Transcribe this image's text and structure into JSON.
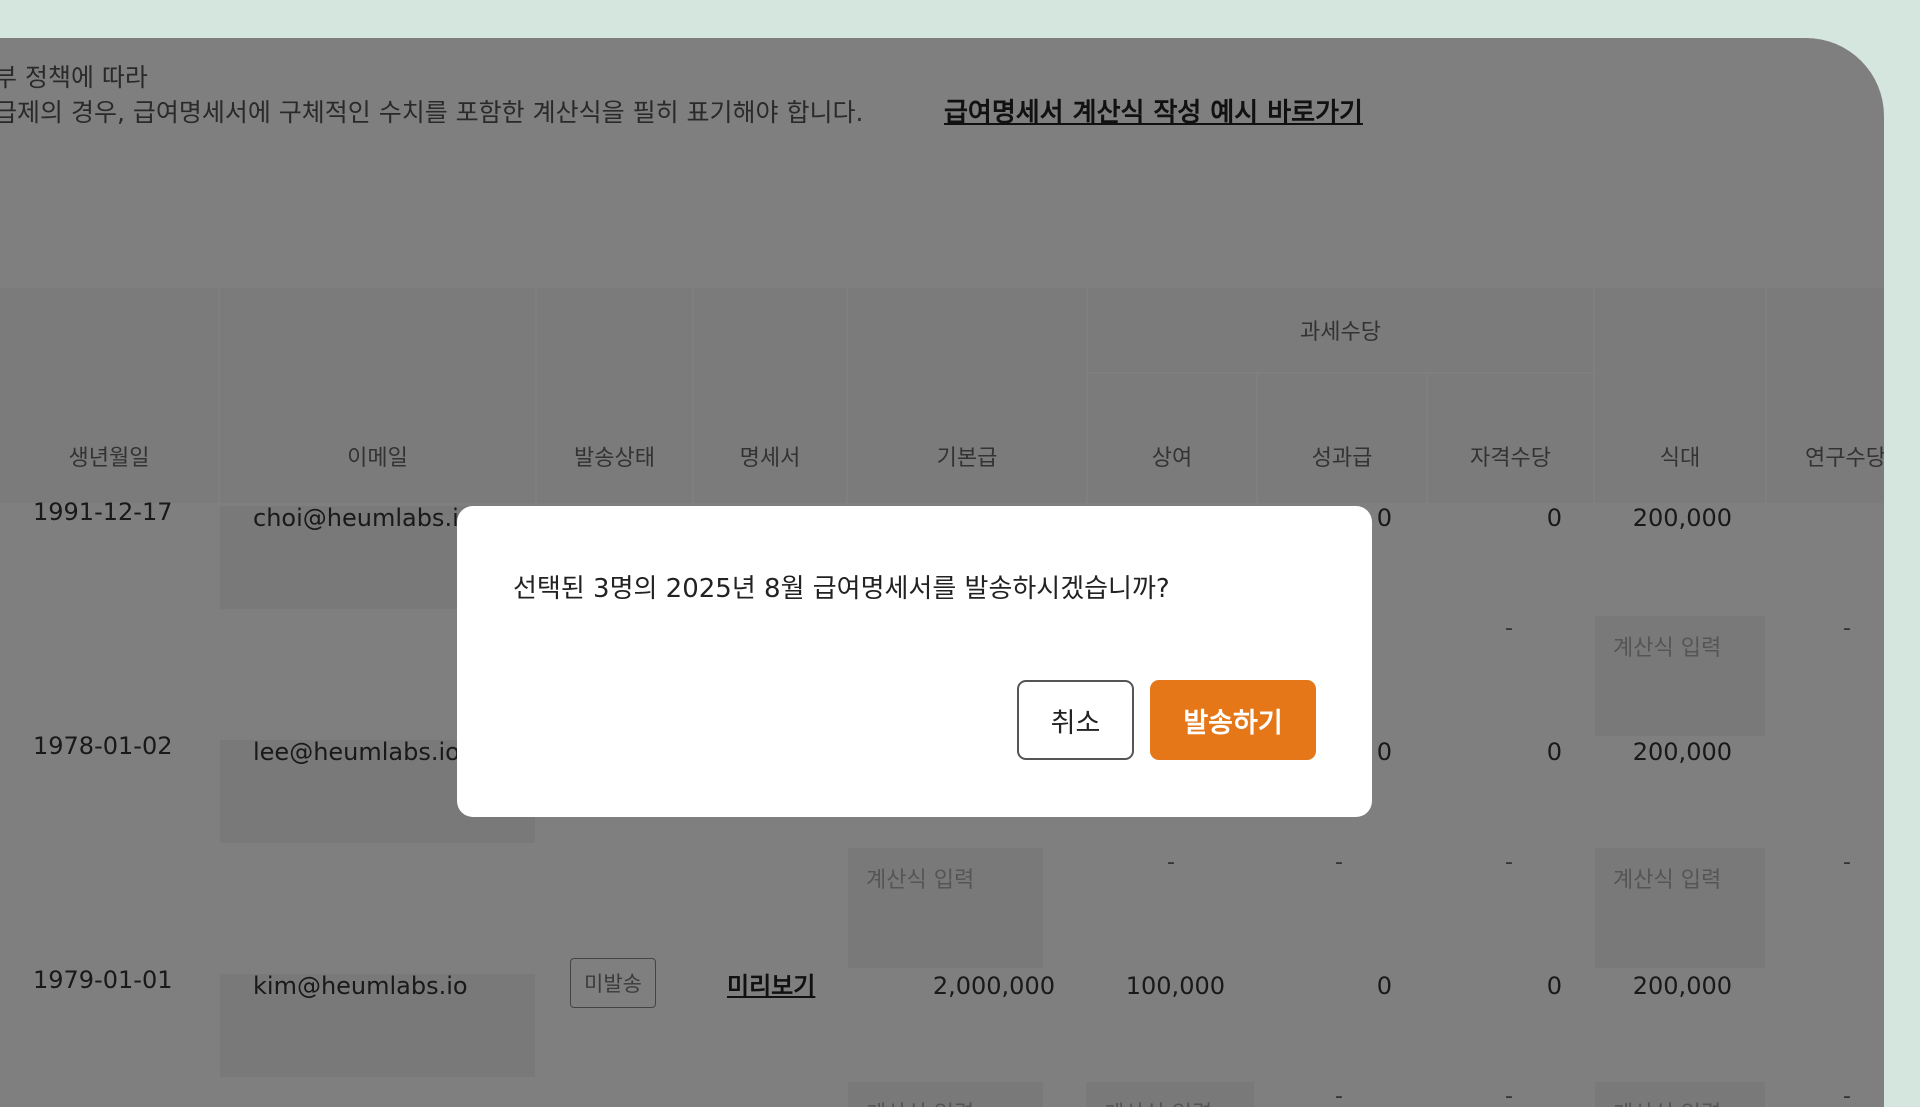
{
  "notice": {
    "line1": "부 정책에 따라",
    "line2": "급제의 경우, 급여명세서에 구체적인 수치를 포함한 계산식을 필히 표기해야 합니다.",
    "link": "급여명세서 계산식 작성 예시 바로가기"
  },
  "table": {
    "group_header": "과세수당",
    "headers": [
      "생년월일",
      "이메일",
      "발송상태",
      "명세서",
      "기본급",
      "상여",
      "성과급",
      "자격수당",
      "식대",
      "연구수당"
    ],
    "formula_placeholder": "계산식 입력",
    "dash": "-",
    "rows": [
      {
        "birth": "1991-12-17",
        "email": "choi@heumlabs.io",
        "perf": "0",
        "cert": "0",
        "meal": "200,000"
      },
      {
        "birth": "1978-01-02",
        "email": "lee@heumlabs.io",
        "perf": "0",
        "cert": "0",
        "meal": "200,000"
      },
      {
        "birth": "1979-01-01",
        "email": "kim@heumlabs.io",
        "status": "미발송",
        "doc": "미리보기",
        "base": "2,000,000",
        "bonus": "100,000",
        "perf": "0",
        "cert": "0",
        "meal": "200,000"
      }
    ]
  },
  "dialog": {
    "message": "선택된 3명의 2025년 8월 급여명세서를 발송하시겠습니까?",
    "cancel_label": "취소",
    "send_label": "발송하기"
  },
  "colors": {
    "accent": "#e57719",
    "frame_bg": "#d5e6df"
  }
}
